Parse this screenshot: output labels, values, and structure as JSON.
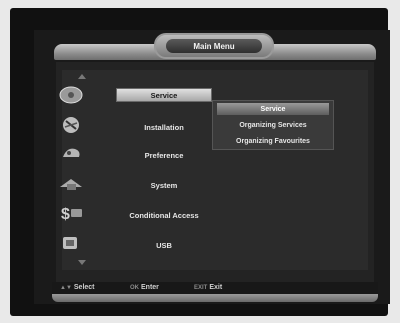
{
  "header": {
    "title": "Main Menu"
  },
  "menu": {
    "items": [
      {
        "label": "Service",
        "icon": "dish-icon",
        "selected": true
      },
      {
        "label": "Installation",
        "icon": "installation-icon",
        "selected": false
      },
      {
        "label": "Preference",
        "icon": "preference-icon",
        "selected": false
      },
      {
        "label": "System",
        "icon": "system-icon",
        "selected": false
      },
      {
        "label": "Conditional Access",
        "icon": "card-icon",
        "selected": false
      },
      {
        "label": "USB",
        "icon": "usb-icon",
        "selected": false
      }
    ]
  },
  "submenu": {
    "items": [
      {
        "label": "Service",
        "highlight": true
      },
      {
        "label": "Organizing Services",
        "highlight": false
      },
      {
        "label": "Organizing Favourites",
        "highlight": false
      }
    ]
  },
  "footer": {
    "select_label": "Select",
    "enter_label": "Enter",
    "exit_label": "Exit"
  },
  "colors": {
    "background": "#1a1a1a",
    "selected": "#d0d0d0",
    "text": "#e6e6e6"
  }
}
